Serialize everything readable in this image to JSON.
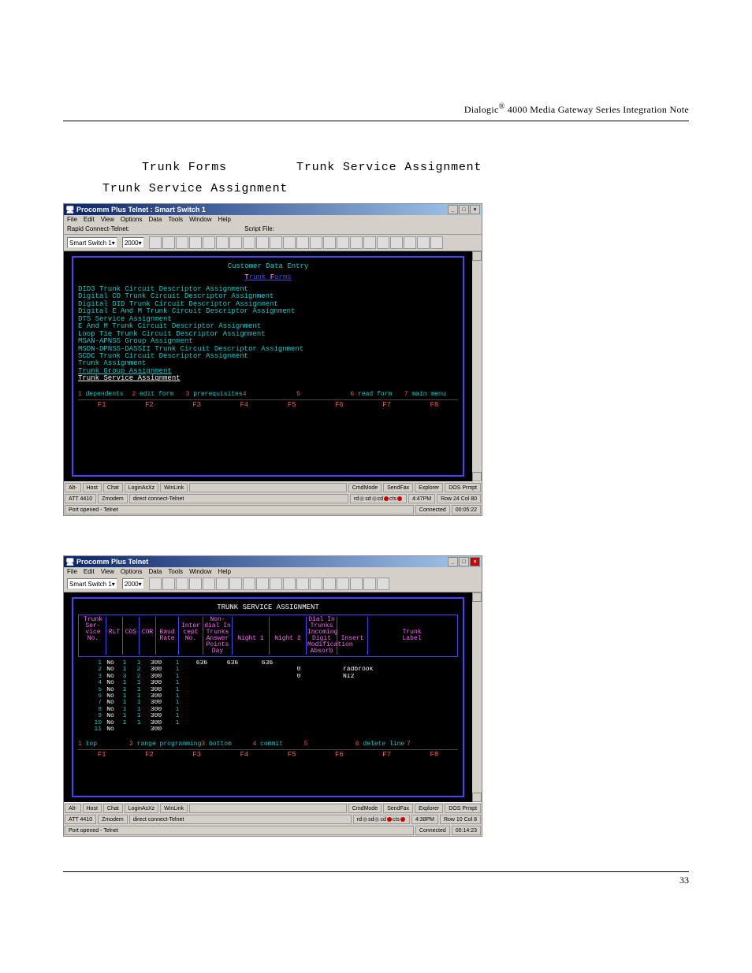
{
  "header": {
    "brand": "Dialogic",
    "reg": "®",
    "rest": " 4000 Media Gateway Series Integration Note"
  },
  "intro": {
    "line1a": "Trunk Forms",
    "line1b": "Trunk Service Assignment",
    "line2": "Trunk Service Assignment"
  },
  "shot1": {
    "title": "Procomm Plus Telnet : Smart Switch 1",
    "menus": [
      "File",
      "Edit",
      "View",
      "Options",
      "Data",
      "Tools",
      "Window",
      "Help"
    ],
    "toolbar": {
      "label1": "Rapid Connect-Telnet:",
      "combo1": "Smart Switch 1",
      "label2": "Script File:",
      "combo2": "2000"
    },
    "terminal": {
      "title": "Customer Data Entry",
      "subtitle": "Trunk Forms",
      "items": [
        "DID3 Trunk Circuit Descriptor Assignment",
        "Digital CO Trunk Circuit Descriptor Assignment",
        "Digital DID Trunk Circuit Descriptor Assignment",
        "Digital E And M Trunk Circuit Descriptor Assignment",
        "DTS Service Assignment",
        "E And M Trunk Circuit Descriptor Assignment",
        "Loop Tie Trunk Circuit Descriptor Assignment",
        "MSAN-APNSS Group Assignment",
        "MSDN-DPNSS-DASSII Trunk Circuit Descriptor Assignment",
        "SCDC Trunk Circuit Descriptor Assignment",
        "Trunk Assignment",
        "Trunk Group Assignment",
        "Trunk Service Assignment"
      ],
      "softkeys": [
        {
          "n": "1",
          "t": "dependents"
        },
        {
          "n": "2",
          "t": "edit form"
        },
        {
          "n": "3",
          "t": "prerequisites"
        },
        {
          "n": "4",
          "t": ""
        },
        {
          "n": "5",
          "t": ""
        },
        {
          "n": "6",
          "t": "read form"
        },
        {
          "n": "7",
          "t": "main menu"
        }
      ],
      "fkeys": [
        "F1",
        "F2",
        "F3",
        "F4",
        "F5",
        "F6",
        "F7",
        "F8"
      ]
    },
    "status": {
      "btns": [
        "Alt-",
        "Host",
        "Chat",
        "LoginAsXz",
        "WinLink",
        "",
        "CmdMode",
        "SendFax",
        "Explorer",
        "DOS Prmpt"
      ],
      "row2": [
        "ATT 4410",
        "Zmodem",
        "direct connect-Telnet",
        "4:47PM",
        "Row 24  Col 80"
      ],
      "row3l": "Port opened - Telnet",
      "row3r1": "Connected",
      "row3r2": "00:05:22"
    }
  },
  "shot2": {
    "title": "Procomm Plus Telnet",
    "menus": [
      "File",
      "Edit",
      "View",
      "Options",
      "Data",
      "Tools",
      "Window",
      "Help"
    ],
    "toolbar": {
      "combo1": "Smart Switch 1",
      "combo2": "2000"
    },
    "terminal": {
      "title": "TRUNK SERVICE ASSIGNMENT",
      "cols": [
        "Trunk\nSer-\nvice\nNo.",
        "RLT",
        "COS",
        "COR",
        "Baud\nRate",
        "Inter\ncept\nNo.",
        "Day",
        "Non-dial In Trunks\nAnswer Points\nNight 1",
        "Night 2",
        "Dial In Trunks\nIncoming Digit\nModification\nAbsorb",
        "Insert",
        "Trunk\nLabel"
      ],
      "rows": [
        {
          "no": "1",
          "rlt": "No",
          "cos": "1",
          "cor": "1",
          "baud": "300",
          "icn": "1",
          "day": "636",
          "n1": "636",
          "n2": "636",
          "ab": "",
          "ins": "",
          "lab": ""
        },
        {
          "no": "2",
          "rlt": "No",
          "cos": "1",
          "cor": "2",
          "baud": "300",
          "icn": "1",
          "day": "",
          "n1": "",
          "n2": "",
          "ab": "0",
          "ins": "",
          "lab": "radbrook"
        },
        {
          "no": "3",
          "rlt": "No",
          "cos": "3",
          "cor": "2",
          "baud": "300",
          "icn": "1",
          "day": "",
          "n1": "",
          "n2": "",
          "ab": "0",
          "ins": "",
          "lab": "NI2"
        },
        {
          "no": "4",
          "rlt": "No",
          "cos": "1",
          "cor": "1",
          "baud": "300",
          "icn": "1",
          "day": "",
          "n1": "",
          "n2": "",
          "ab": "",
          "ins": "",
          "lab": ""
        },
        {
          "no": "5",
          "rlt": "No",
          "cos": "1",
          "cor": "1",
          "baud": "300",
          "icn": "1",
          "day": "",
          "n1": "",
          "n2": "",
          "ab": "",
          "ins": "",
          "lab": ""
        },
        {
          "no": "6",
          "rlt": "No",
          "cos": "1",
          "cor": "1",
          "baud": "300",
          "icn": "1",
          "day": "",
          "n1": "",
          "n2": "",
          "ab": "",
          "ins": "",
          "lab": ""
        },
        {
          "no": "7",
          "rlt": "No",
          "cos": "1",
          "cor": "1",
          "baud": "300",
          "icn": "1",
          "day": "",
          "n1": "",
          "n2": "",
          "ab": "",
          "ins": "",
          "lab": ""
        },
        {
          "no": "8",
          "rlt": "No",
          "cos": "1",
          "cor": "1",
          "baud": "300",
          "icn": "1",
          "day": "",
          "n1": "",
          "n2": "",
          "ab": "",
          "ins": "",
          "lab": ""
        },
        {
          "no": "9",
          "rlt": "No",
          "cos": "1",
          "cor": "1",
          "baud": "300",
          "icn": "1",
          "day": "",
          "n1": "",
          "n2": "",
          "ab": "",
          "ins": "",
          "lab": ""
        },
        {
          "no": "10",
          "rlt": "No",
          "cos": "1",
          "cor": "1",
          "baud": "300",
          "icn": "1",
          "day": "",
          "n1": "",
          "n2": "",
          "ab": "",
          "ins": "",
          "lab": ""
        },
        {
          "no": "11",
          "rlt": "No",
          "cos": "",
          "cor": "",
          "baud": "300",
          "icn": "",
          "day": "",
          "n1": "",
          "n2": "",
          "ab": "",
          "ins": "",
          "lab": ""
        }
      ],
      "softkeys": [
        {
          "n": "1",
          "t": "top"
        },
        {
          "n": "2",
          "t": "range programming"
        },
        {
          "n": "3",
          "t": "bottom"
        },
        {
          "n": "4",
          "t": "commit"
        },
        {
          "n": "5",
          "t": ""
        },
        {
          "n": "6",
          "t": "delete line"
        },
        {
          "n": "7",
          "t": ""
        }
      ],
      "fkeys": [
        "F1",
        "F2",
        "F3",
        "F4",
        "F5",
        "F6",
        "F7",
        "F8"
      ]
    },
    "status": {
      "btns": [
        "Alt-",
        "Host",
        "Chat",
        "LoginAsXz",
        "WinLink",
        "",
        "CmdMode",
        "SendFax",
        "Explorer",
        "DOS Prmpt"
      ],
      "row2": [
        "ATT 4410",
        "Zmodem",
        "direct connect-Telnet",
        "4:38PM",
        "Row 10  Col 8"
      ],
      "row3l": "Port opened - Telnet",
      "row3r1": "Connected",
      "row3r2": "00:14:23"
    }
  },
  "page_number": "33"
}
